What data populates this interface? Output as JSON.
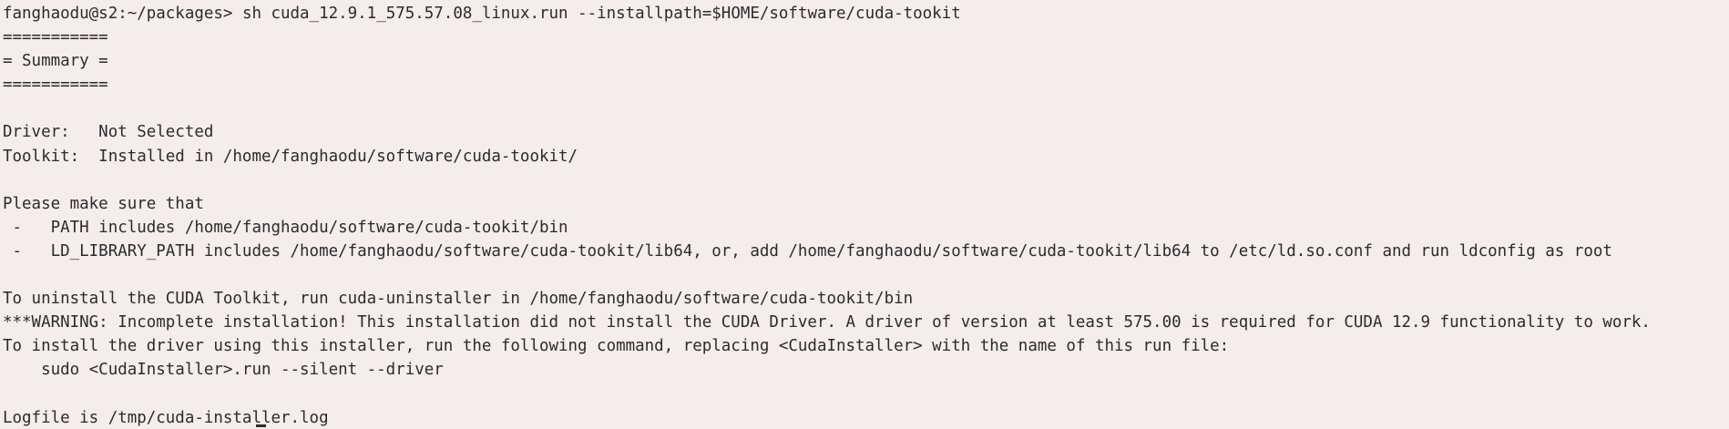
{
  "terminal": {
    "prompt": "fanghaodu@s2:~/packages>",
    "command": "sh cuda_12.9.1_575.57.08_linux.run --installpath=$HOME/software/cuda-tookit",
    "lines": [
      "===========",
      "= Summary =",
      "===========",
      "",
      "Driver:   Not Selected",
      "Toolkit:  Installed in /home/fanghaodu/software/cuda-tookit/",
      "",
      "Please make sure that",
      " -   PATH includes /home/fanghaodu/software/cuda-tookit/bin",
      " -   LD_LIBRARY_PATH includes /home/fanghaodu/software/cuda-tookit/lib64, or, add /home/fanghaodu/software/cuda-tookit/lib64 to /etc/ld.so.conf and run ldconfig as root",
      "",
      "To uninstall the CUDA Toolkit, run cuda-uninstaller in /home/fanghaodu/software/cuda-tookit/bin",
      "***WARNING: Incomplete installation! This installation did not install the CUDA Driver. A driver of version at least 575.00 is required for CUDA 12.9 functionality to work.",
      "To install the driver using this installer, run the following command, replacing <CudaInstaller> with the name of this run file:",
      "    sudo <CudaInstaller>.run --silent --driver",
      "",
      "Logfile is /tmp/cuda-installer.log"
    ]
  }
}
